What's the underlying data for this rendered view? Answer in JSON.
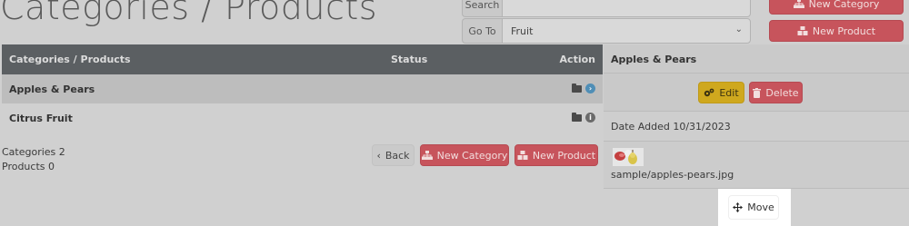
{
  "page": {
    "title": "Categories / Products"
  },
  "search": {
    "label": "Search",
    "value": ""
  },
  "goto": {
    "label": "Go To",
    "selected": "Fruit"
  },
  "top_buttons": {
    "new_category": "New Category",
    "new_product": "New Product"
  },
  "table": {
    "headers": {
      "name": "Categories / Products",
      "status": "Status",
      "action": "Action"
    },
    "rows": [
      {
        "label": "Apples & Pears"
      },
      {
        "label": "Citrus Fruit"
      }
    ]
  },
  "stats": {
    "categories": "Categories 2",
    "products": "Products 0"
  },
  "bottom_buttons": {
    "back": "Back",
    "new_category": "New Category",
    "new_product": "New Product"
  },
  "detail": {
    "title": "Apples & Pears",
    "edit": "Edit",
    "delete": "Delete",
    "date_added": "Date Added 10/31/2023",
    "image_path": "sample/apples-pears.jpg"
  },
  "move": {
    "label": "Move"
  },
  "colors": {
    "danger": "#c7545c",
    "warning": "#cfa81e",
    "header": "#5b5f62",
    "info": "#4f8eb6"
  }
}
